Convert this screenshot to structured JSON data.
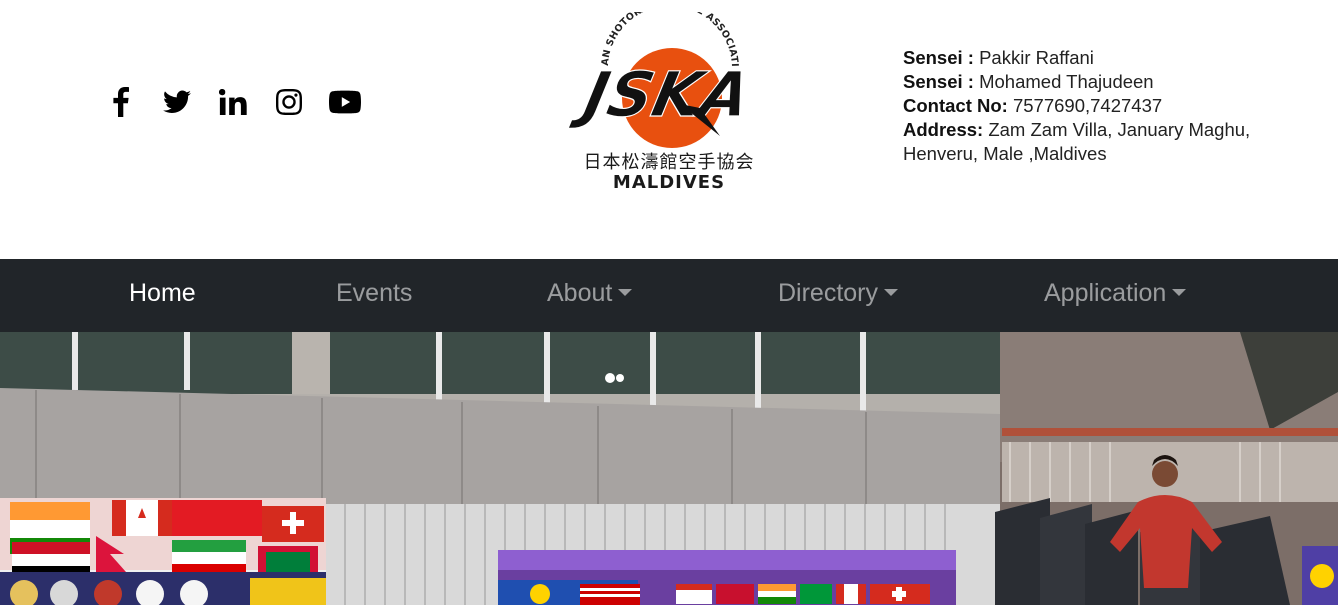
{
  "social": {
    "icons": [
      "facebook-icon",
      "twitter-icon",
      "linkedin-icon",
      "instagram-icon",
      "youtube-icon"
    ]
  },
  "logo": {
    "arc_text": "JAPAN SHOTOKAN KARATE ASSOCIATION",
    "letters": "JSKA",
    "kanji": "日本松濤館空手協会",
    "country": "MALDIVES",
    "colors": {
      "sun": "#e8500f",
      "letters": "#111111"
    }
  },
  "contact": {
    "sensei1_label": "Sensei :",
    "sensei1_value": " Pakkir Raffani",
    "sensei2_label": "Sensei :",
    "sensei2_value": " Mohamed Thajudeen",
    "phone_label": "Contact No:",
    "phone_value": " 7577690,7427437",
    "address_label": "Address:",
    "address_value": " Zam Zam Villa, January Maghu, Henveru, Male ,Maldives"
  },
  "nav": {
    "background": "#212529",
    "items": [
      {
        "label": "Home",
        "active": true,
        "dropdown": false
      },
      {
        "label": "Events",
        "active": false,
        "dropdown": false
      },
      {
        "label": "About",
        "active": false,
        "dropdown": true
      },
      {
        "label": "Directory",
        "active": false,
        "dropdown": true
      },
      {
        "label": "Application",
        "active": false,
        "dropdown": true
      }
    ]
  }
}
